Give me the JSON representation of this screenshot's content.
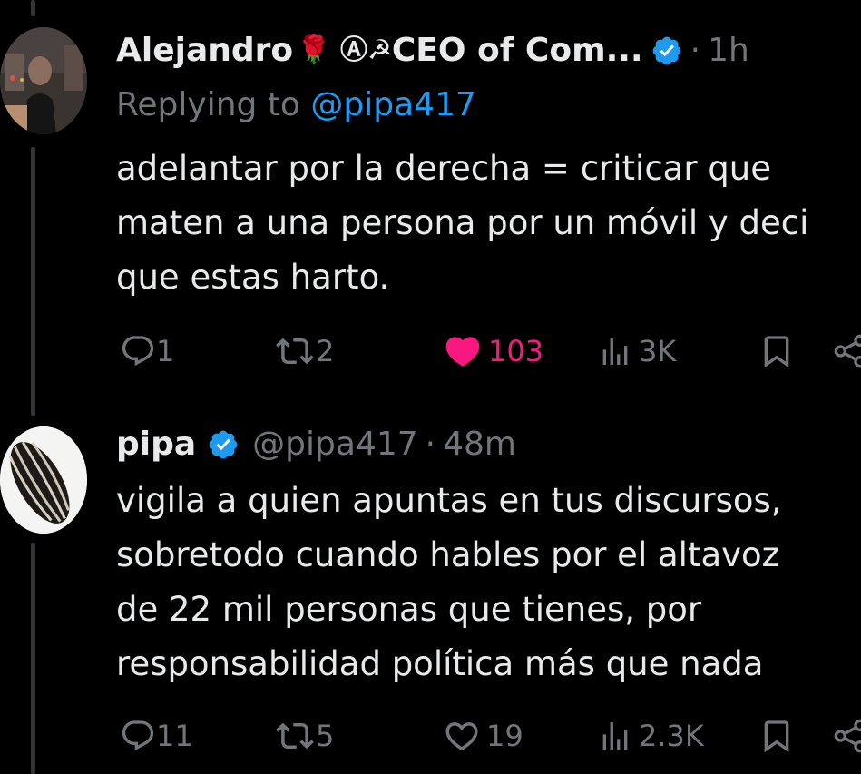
{
  "tweets": [
    {
      "author_name": "Alejandro",
      "author_emojis": "🌹 Ⓐ☭",
      "author_name_rest": "CEO of Com...",
      "separator": "·",
      "time": "1h",
      "reply_prefix": "Replying to ",
      "reply_mention": "@pipa417",
      "body_lines": [
        "adelantar por la derecha = criticar que",
        "maten a una persona por un móvil y deci",
        "que estas harto."
      ],
      "actions": {
        "reply_count": "1",
        "retweet_count": "2",
        "like_count": "103",
        "views_count": "3K"
      },
      "liked": true,
      "avatar_icon": "person-photo-avatar"
    },
    {
      "author_name": "pipa",
      "handle": "@pipa417",
      "separator": "·",
      "time": "48m",
      "body_lines": [
        "vigila a quien apuntas en tus discursos,",
        "sobretodo cuando hables por el altavoz",
        "de 22 mil personas que tienes, por",
        "responsabilidad política más que nada"
      ],
      "actions": {
        "reply_count": "11",
        "retweet_count": "5",
        "like_count": "19",
        "views_count": "2.3K"
      },
      "liked": false,
      "avatar_icon": "sunflower-seed-avatar"
    }
  ],
  "colors": {
    "background": "#000000",
    "text": "#e7e9ea",
    "muted": "#71767b",
    "accent": "#1d9bf0",
    "like": "#f91880",
    "verified": "#1d9bf0"
  }
}
